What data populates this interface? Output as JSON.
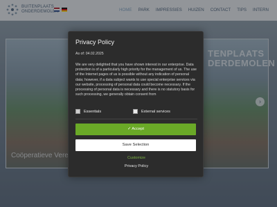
{
  "site": {
    "logo_line1": "BUITENPLAATS",
    "logo_line2": "ONDERDEMOLEN",
    "nav": [
      "HOME",
      "PARK",
      "IMPRESSIES",
      "HUIZEN",
      "CONTACT",
      "TIPS",
      "INTERN"
    ],
    "active_nav": "HOME",
    "hero_title_line1": "TENPLAATS",
    "hero_title_line2": "DERDEMOLEN",
    "hero_caption": "Coöperatieve Vere",
    "slider_next_icon": "›"
  },
  "modal": {
    "title": "Privacy Policy",
    "date": "As of: 04.02.2025",
    "text": "We are very delighted that you have shown interest in our enterprise. Data protection is of a particularly high priority for the management of us. The use of the Internet pages of us is possible without any indication of personal data; however, if a data subject wants to use special enterprise services via our website, processing of personal data could become necessary. If the processing of personal data is necessary and there is no statutory basis for such processing, we generally obtain consent from",
    "essentials_label": "Essentials",
    "external_label": "External services",
    "accept_label": "✓ Accept",
    "save_label": "Save Selection",
    "customize_label": "Customize",
    "policy_link_label": "Privacy Policy"
  },
  "colors": {
    "accent_green": "#6aa927",
    "modal_bg": "#2c2c2c"
  }
}
